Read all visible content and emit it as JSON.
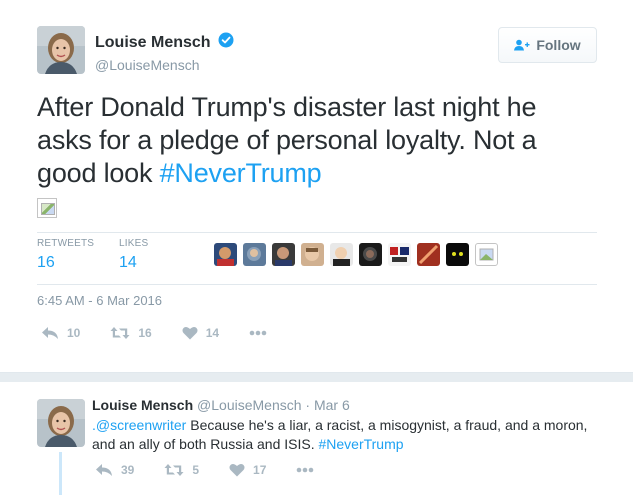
{
  "tweet": {
    "author_name": "Louise Mensch",
    "screen_name": "@LouiseMensch",
    "follow_label": "Follow",
    "text_main": "After Donald Trump's disaster last night he asks for a pledge of personal loyalty. Not a good look ",
    "hashtag": "#NeverTrump",
    "stats": {
      "retweets_label": "RETWEETS",
      "retweets_value": "16",
      "likes_label": "LIKES",
      "likes_value": "14"
    },
    "timestamp": "6:45 AM - 6 Mar 2016",
    "actions": {
      "reply_count": "10",
      "retweet_count": "16",
      "like_count": "14"
    }
  },
  "reply": {
    "author_name": "Louise Mensch",
    "screen_name": "@LouiseMensch",
    "separator": " · ",
    "date": "Mar 6",
    "mention": ".@screenwriter",
    "text": " Because he's a liar, a racist, a misogynist, a fraud, and a moron, and an ally of both Russia and ISIS. ",
    "hashtag": "#NeverTrump",
    "actions": {
      "reply_count": "39",
      "retweet_count": "5",
      "like_count": "17"
    }
  },
  "colors": {
    "link_blue": "#1da1f2",
    "muted_gray": "#8899a6",
    "action_gray": "#aab8c2",
    "verified_blue": "#1da1f2"
  },
  "icons": [
    "verified-badge-icon",
    "follow-person-plus-icon",
    "reply-arrow-icon",
    "retweet-icon",
    "heart-icon",
    "more-dots-icon",
    "broken-image-icon"
  ]
}
